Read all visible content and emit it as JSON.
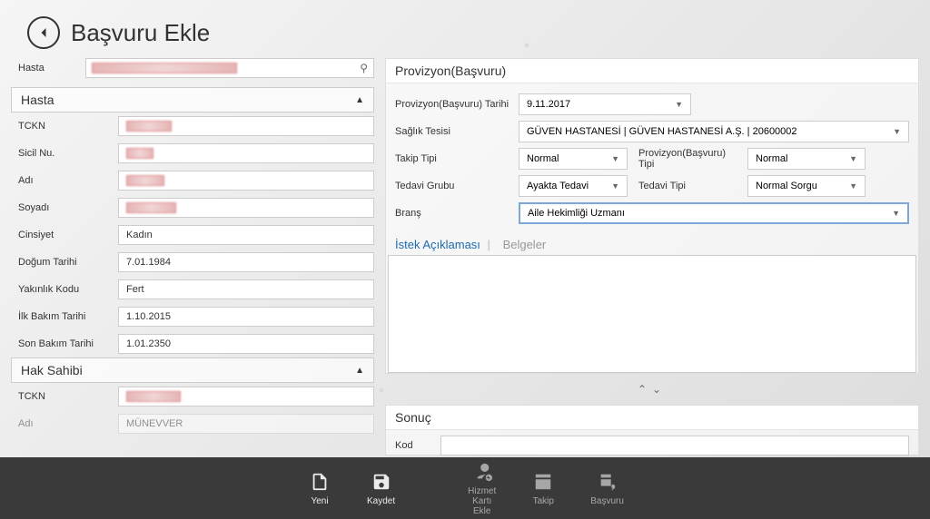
{
  "header": {
    "title": "Başvuru Ekle"
  },
  "search": {
    "label": "Hasta"
  },
  "sections": {
    "hasta": {
      "title": "Hasta",
      "fields": {
        "tckn": {
          "label": "TCKN",
          "value": ""
        },
        "sicil": {
          "label": "Sicil Nu.",
          "value": ""
        },
        "adi": {
          "label": "Adı",
          "value": ""
        },
        "soyadi": {
          "label": "Soyadı",
          "value": ""
        },
        "cinsiyet": {
          "label": "Cinsiyet",
          "value": "Kadın"
        },
        "dogum": {
          "label": "Doğum Tarihi",
          "value": "7.01.1984"
        },
        "yakinlik": {
          "label": "Yakınlık Kodu",
          "value": "Fert"
        },
        "ilkbakim": {
          "label": "İlk Bakım Tarihi",
          "value": "1.10.2015"
        },
        "sonbakim": {
          "label": "Son Bakım Tarihi",
          "value": "1.01.2350"
        }
      }
    },
    "haksahibi": {
      "title": "Hak Sahibi",
      "fields": {
        "tckn": {
          "label": "TCKN",
          "value": ""
        },
        "adi": {
          "label": "Adı",
          "value": "MÜNEVVER"
        }
      }
    }
  },
  "provizyon": {
    "panel_title": "Provizyon(Başvuru)",
    "tarih": {
      "label": "Provizyon(Başvuru) Tarihi",
      "value": "9.11.2017"
    },
    "tesis": {
      "label": "Sağlık Tesisi",
      "value": "GÜVEN HASTANESİ | GÜVEN HASTANESİ A.Ş. | 20600002"
    },
    "takip_tipi": {
      "label": "Takip Tipi",
      "value": "Normal"
    },
    "prov_tipi": {
      "label": "Provizyon(Başvuru) Tipi",
      "value": "Normal"
    },
    "tedavi_grubu": {
      "label": "Tedavi Grubu",
      "value": "Ayakta Tedavi"
    },
    "tedavi_tipi": {
      "label": "Tedavi Tipi",
      "value": "Normal Sorgu"
    },
    "brans": {
      "label": "Branş",
      "value": "Aile Hekimliği Uzmanı"
    }
  },
  "tabs": {
    "istek": "İstek Açıklaması",
    "belgeler": "Belgeler"
  },
  "sonuc": {
    "panel_title": "Sonuç",
    "kod_label": "Kod"
  },
  "appbar": {
    "yeni": "Yeni",
    "kaydet": "Kaydet",
    "hizmet": "Hizmet Kartı Ekle",
    "takip": "Takip",
    "basvuru": "Başvuru"
  }
}
